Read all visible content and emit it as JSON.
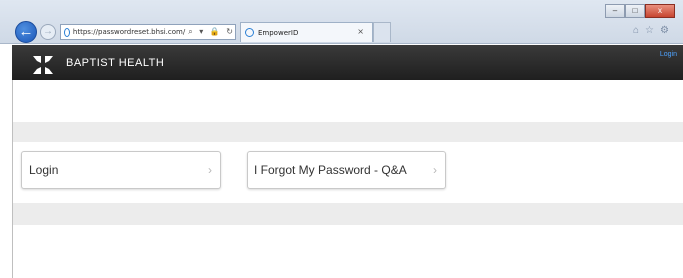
{
  "browser": {
    "url": "https://passwordreset.bhsi.com/",
    "tab_title": "EmpowerID",
    "window_buttons": {
      "minimize": "–",
      "maximize": "□",
      "close": "x"
    },
    "address_icons": "⌕ ▾ 🔒 ↻"
  },
  "header": {
    "brand_name": "BAPTIST HEALTH",
    "login_link": "Login",
    "logo_icon": "baptist-health-logo"
  },
  "main": {
    "buttons": [
      {
        "label": "Login",
        "chevron": "›"
      },
      {
        "label": "I Forgot My Password - Q&A",
        "chevron": "›"
      }
    ]
  },
  "colors": {
    "header_bg": "#262626",
    "band_bg": "#ececec",
    "link": "#4ea3ff"
  }
}
